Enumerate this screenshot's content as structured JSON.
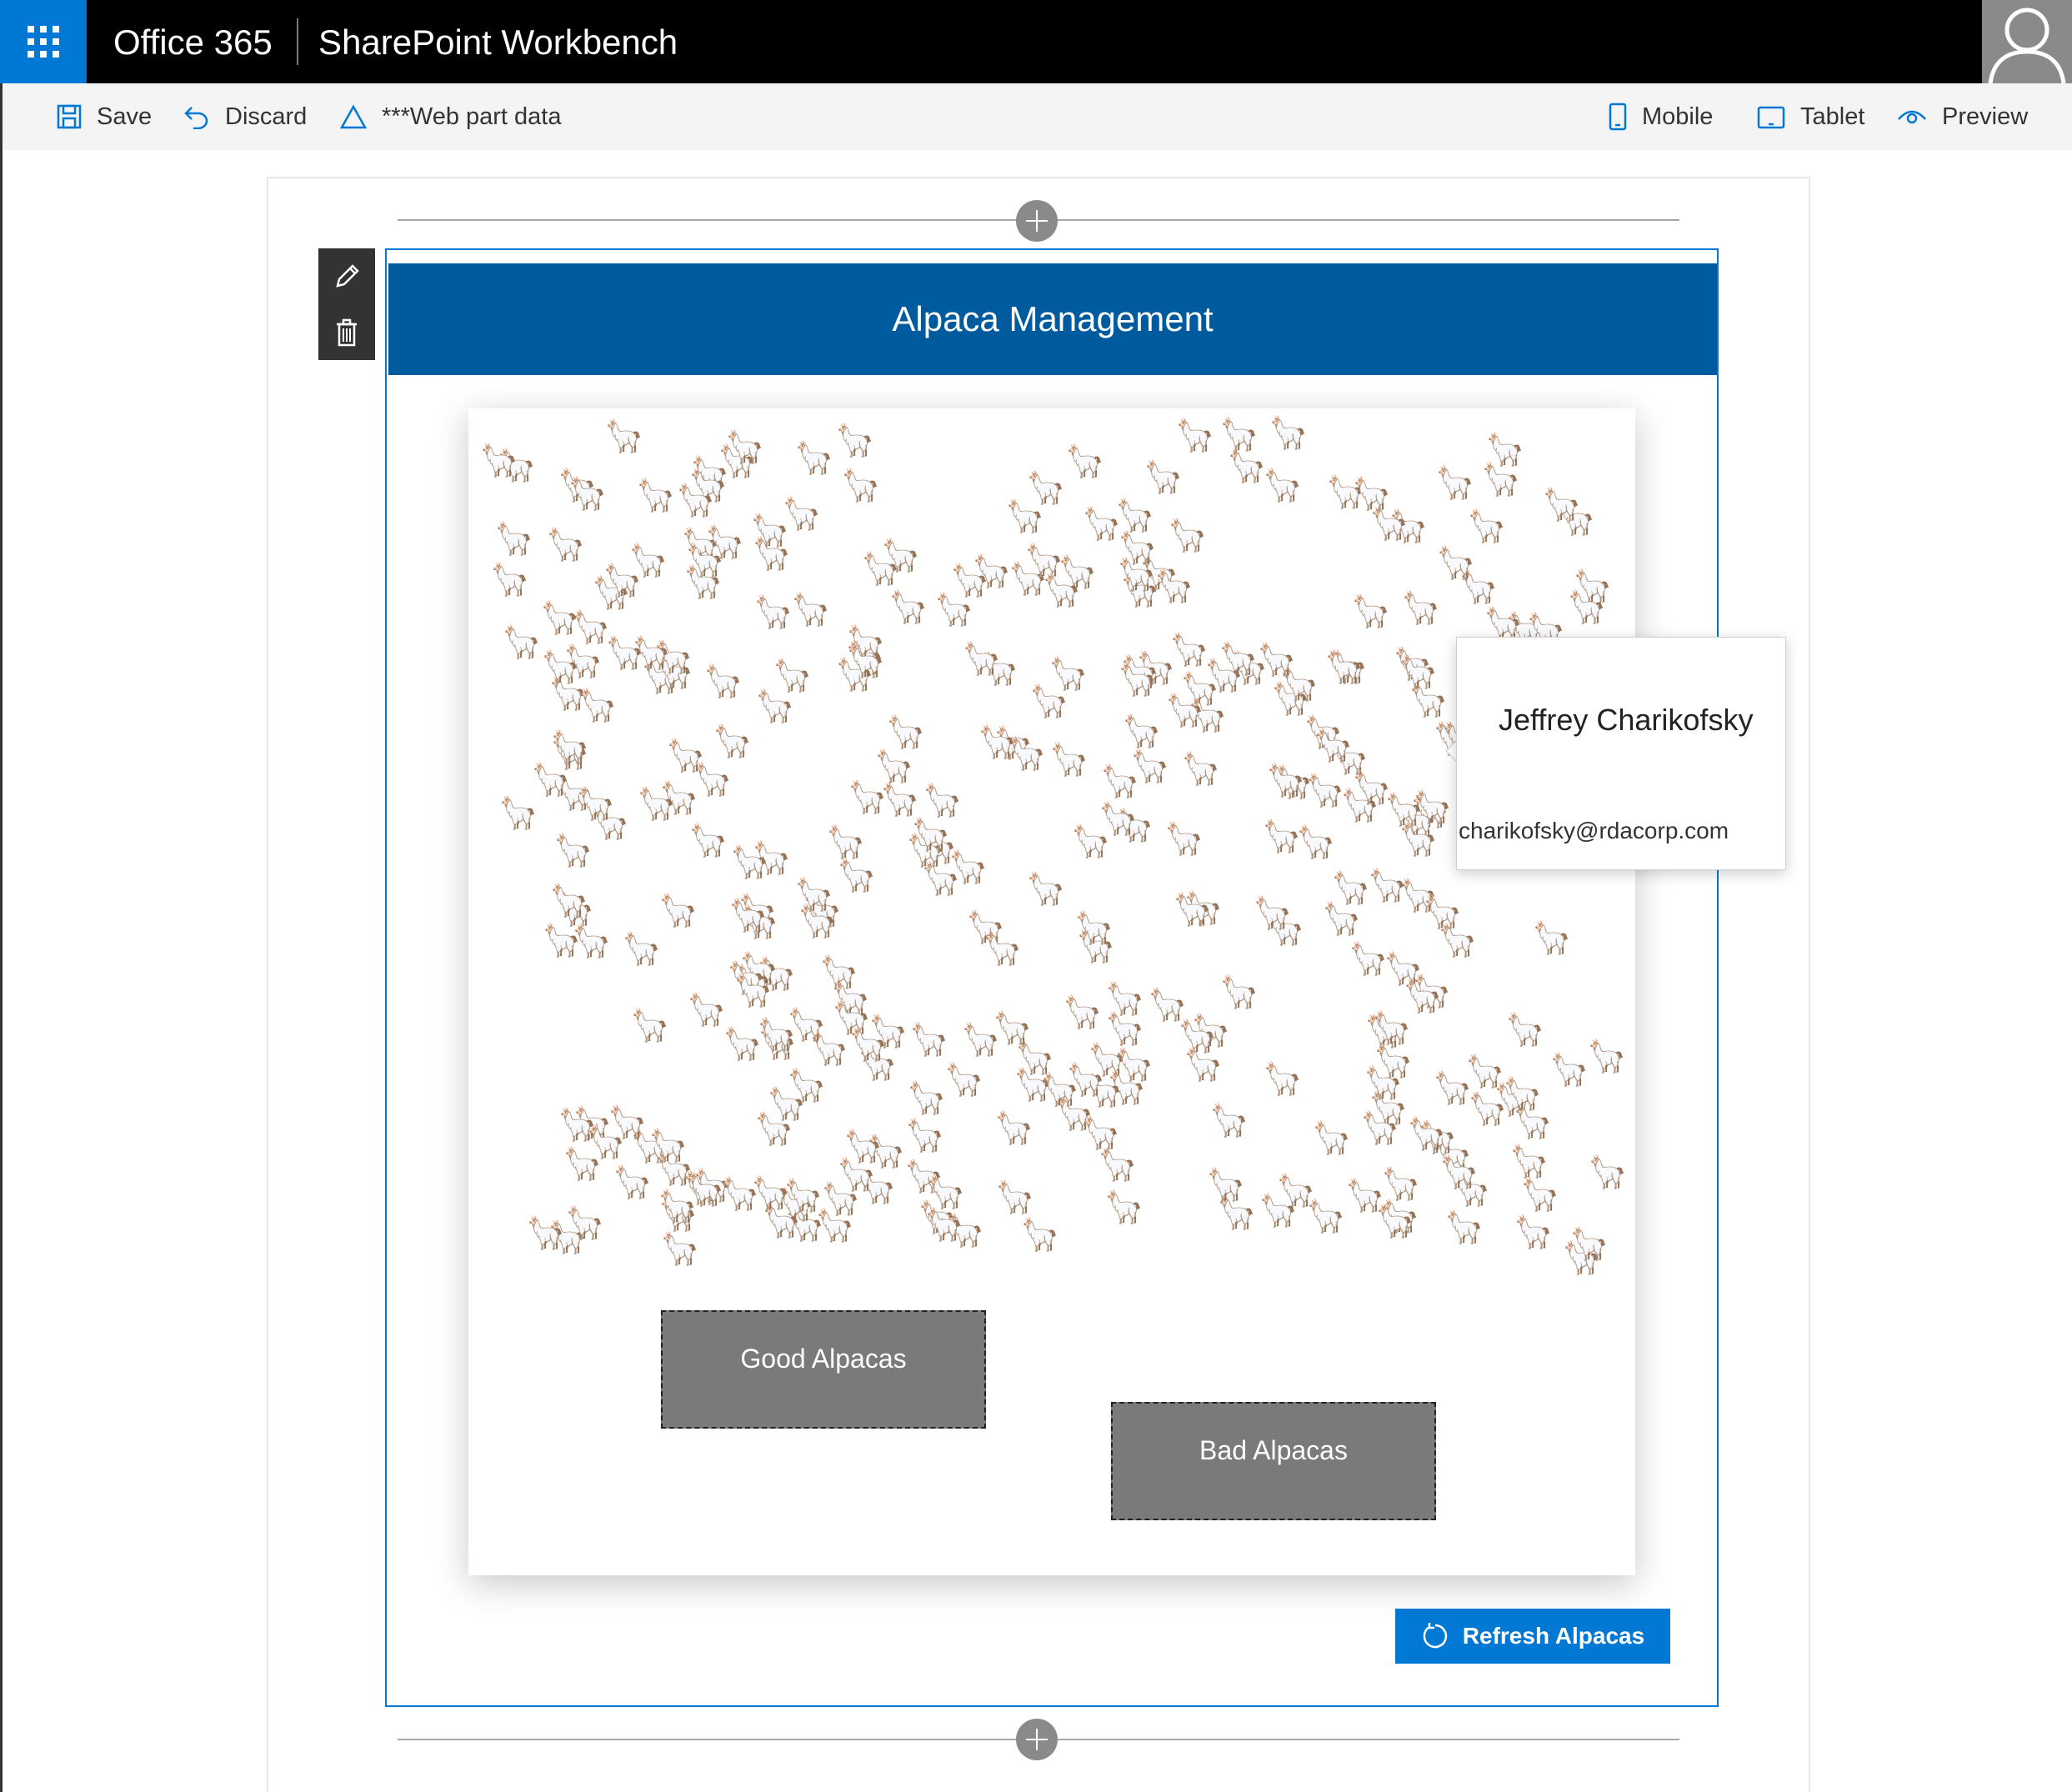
{
  "suite_bar": {
    "brand": "Office 365",
    "app_title": "SharePoint Workbench"
  },
  "command_bar": {
    "save": "Save",
    "discard": "Discard",
    "web_part_data": "***Web part data",
    "mobile": "Mobile",
    "tablet": "Tablet",
    "preview": "Preview"
  },
  "web_part": {
    "title": "Alpaca Management",
    "good_pen_label": "Good Alpacas",
    "bad_pen_label": "Bad Alpacas",
    "refresh_label": "Refresh Alpacas",
    "alpaca_glyph": "🦙"
  },
  "callout": {
    "name": "Jeffrey Charikofsky",
    "email": "charikofsky@rdacorp.com"
  },
  "colors": {
    "suite_black": "#000000",
    "waffle_blue": "#0078d4",
    "header_blue": "#005a9e",
    "pen_gray": "#7a7a7a",
    "alpaca_tan": "#f5d7a1"
  }
}
